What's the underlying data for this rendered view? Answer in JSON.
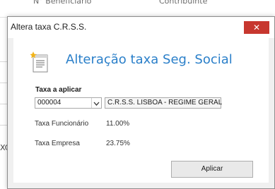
{
  "background": {
    "col1_header": "N° Beneficiário",
    "col2_header": "Contribuinte",
    "side_text": "XC"
  },
  "dialog": {
    "window_title": "Altera taxa C.R.S.S.",
    "close_glyph": "✕",
    "heading": "Alteração taxa Seg. Social",
    "section_label": "Taxa a aplicar",
    "code_value": "000004",
    "description_value": "C.R.S.S. LISBOA - REGIME GERAL",
    "funcionario_label": "Taxa Funcionário",
    "funcionario_value": "11.00%",
    "empresa_label": "Taxa Empresa",
    "empresa_value": "23.75%",
    "apply_label": "Aplicar"
  },
  "colors": {
    "accent": "#2a7fc9",
    "close_button": "#c7372f"
  },
  "icons": {
    "header_icon": "document-with-sparkle-icon",
    "dropdown_icon": "chevron-down-icon"
  }
}
